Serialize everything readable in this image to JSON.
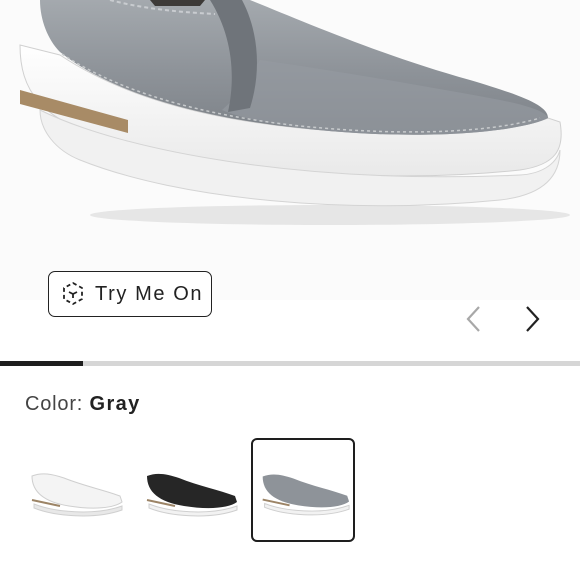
{
  "gallery": {
    "product_image_icon": "gray-slip-on-sneaker",
    "try_on_label": "Try Me On",
    "try_on_icon": "ar-cube-icon",
    "prev_icon": "chevron-left-icon",
    "next_icon": "chevron-right-icon",
    "progress_fraction": 0.143
  },
  "color": {
    "label": "Color:",
    "selected": "Gray",
    "options": [
      {
        "name": "White",
        "hex": "#f2f2f2"
      },
      {
        "name": "Black",
        "hex": "#2a2a2a"
      },
      {
        "name": "Gray",
        "hex": "#8e9399"
      }
    ]
  }
}
